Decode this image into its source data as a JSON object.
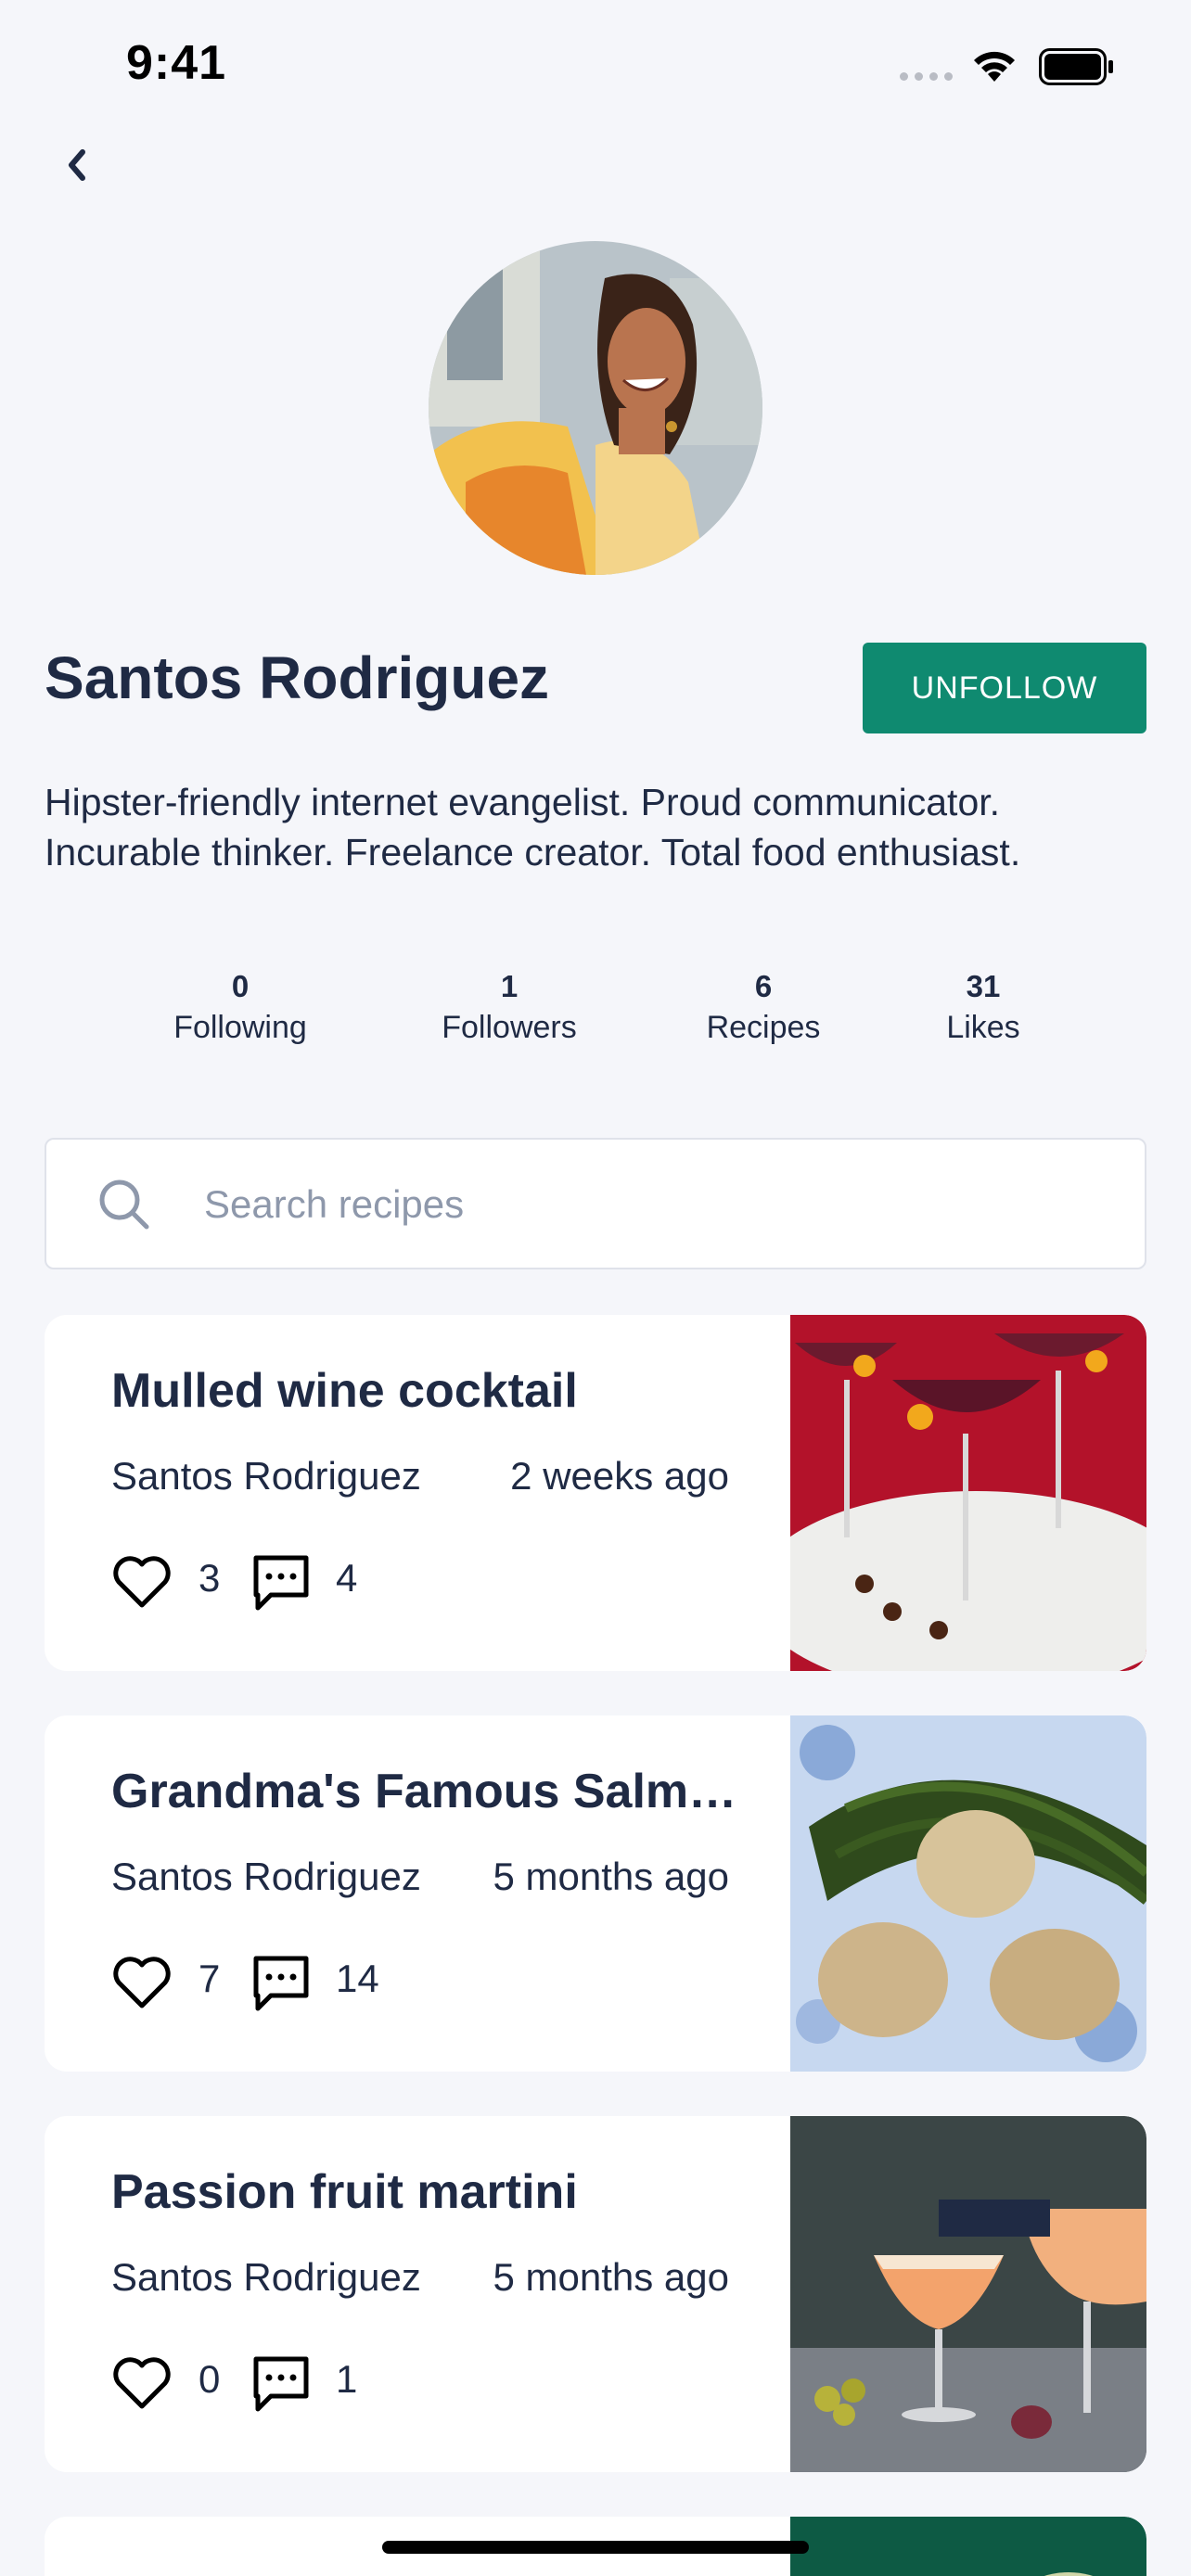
{
  "status_bar": {
    "time": "9:41"
  },
  "profile": {
    "name": "Santos Rodriguez",
    "follow_button_label": "UNFOLLOW",
    "bio": "Hipster-friendly internet evangelist. Proud communicator. Incurable thinker. Freelance creator. Total food enthusiast.",
    "accent_color": "#0f8a70"
  },
  "stats": [
    {
      "value": "0",
      "label": "Following"
    },
    {
      "value": "1",
      "label": "Followers"
    },
    {
      "value": "6",
      "label": "Recipes"
    },
    {
      "value": "31",
      "label": "Likes"
    }
  ],
  "search": {
    "placeholder": "Search recipes",
    "icon": "search-icon"
  },
  "recipes": [
    {
      "title": "Mulled wine cocktail",
      "author": "Santos Rodriguez",
      "time": "2 weeks ago",
      "likes": "3",
      "comments": "4"
    },
    {
      "title": "Grandma's Famous Salmo…",
      "author": "Santos Rodriguez",
      "time": "5 months ago",
      "likes": "7",
      "comments": "14"
    },
    {
      "title": "Passion fruit martini",
      "author": "Santos Rodriguez",
      "time": "5 months ago",
      "likes": "0",
      "comments": "1"
    }
  ]
}
